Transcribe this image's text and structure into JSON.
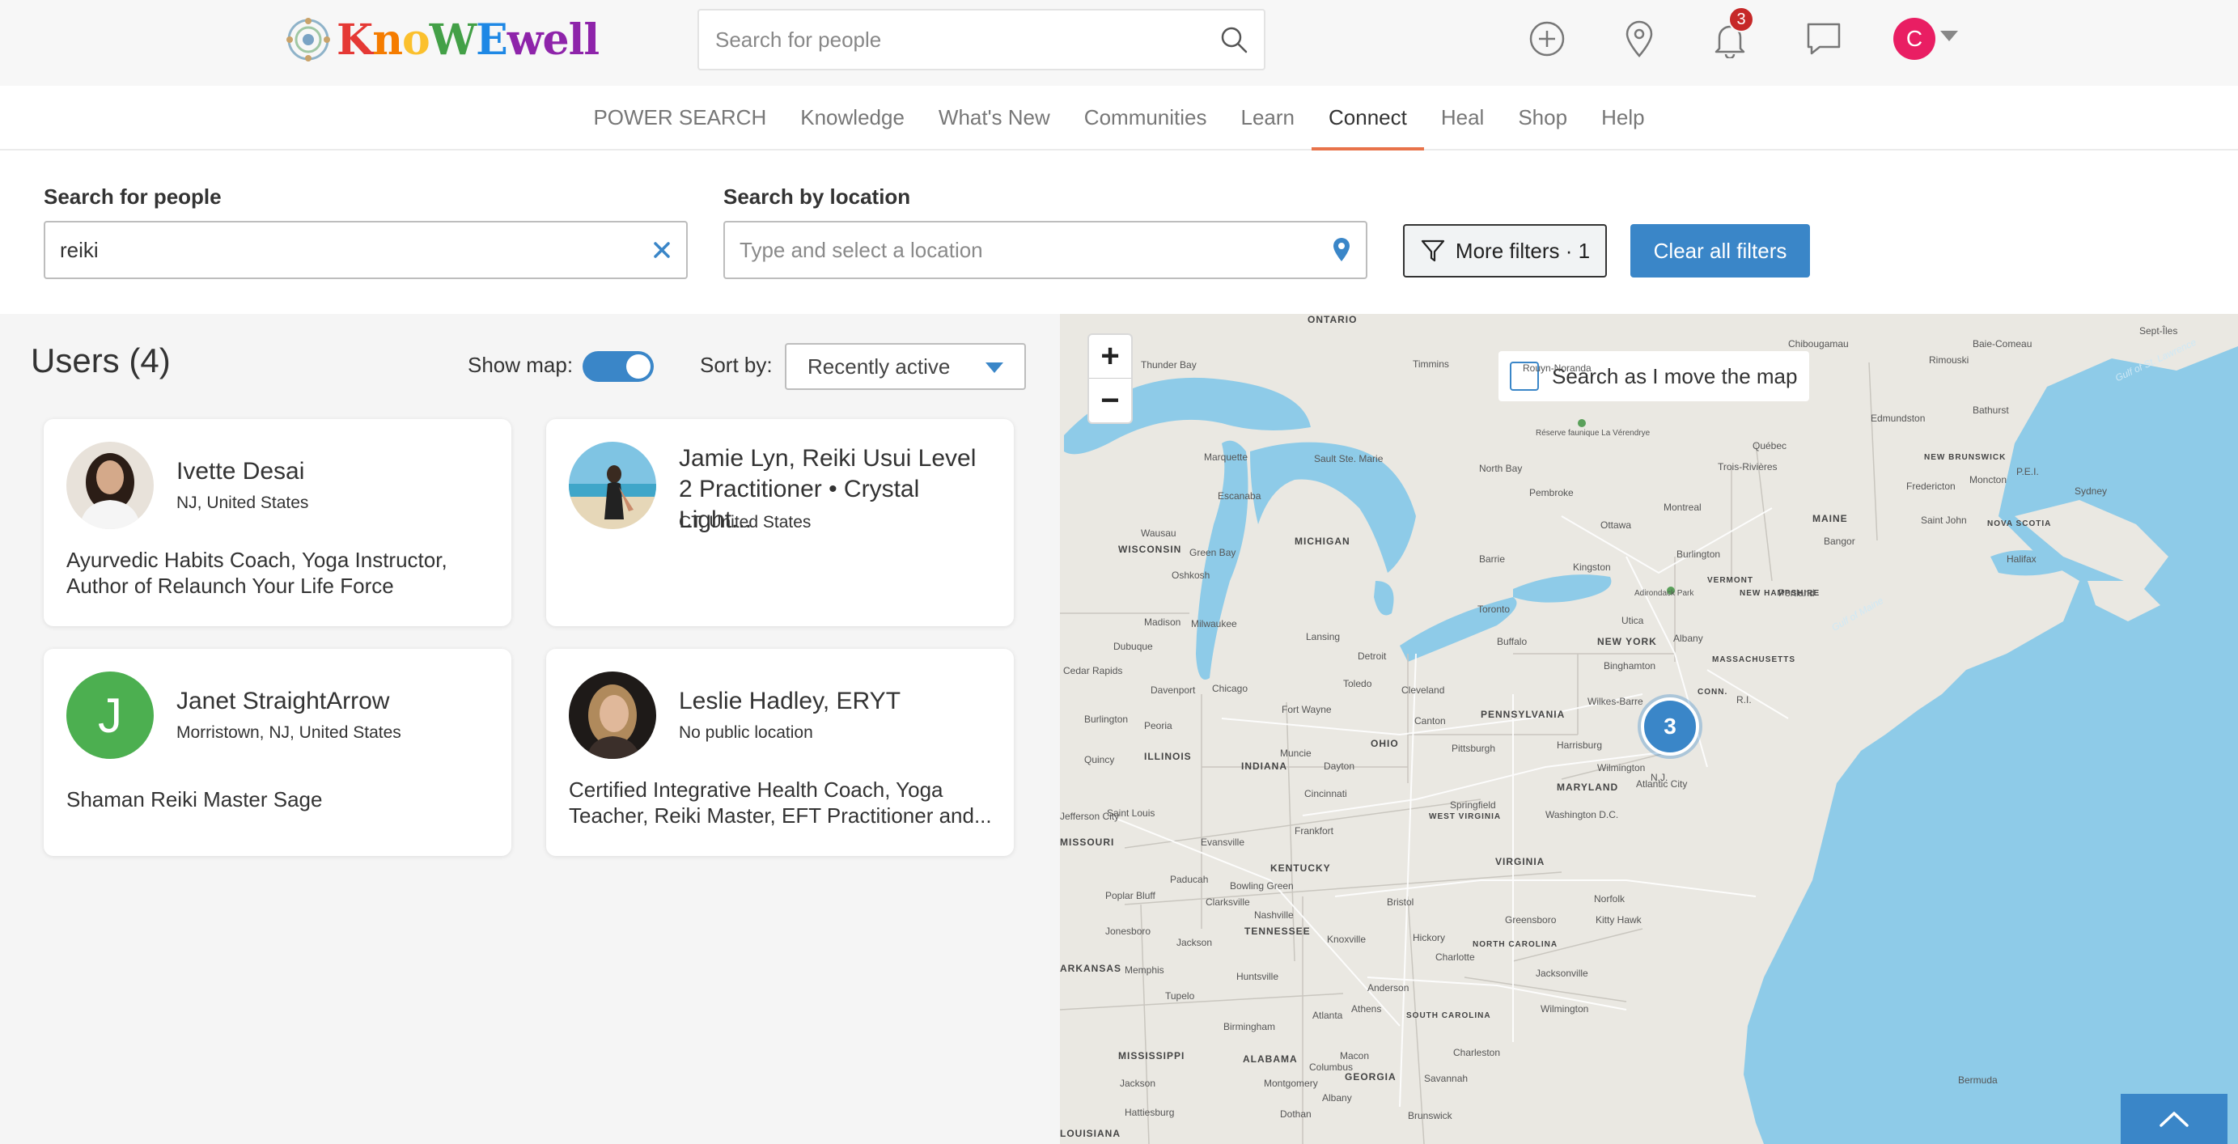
{
  "header": {
    "logo_text": "KnoWEwell",
    "search_placeholder": "Search for people",
    "notification_count": "3",
    "user_initial": "C"
  },
  "nav": {
    "items": [
      {
        "label": "POWER SEARCH",
        "active": false
      },
      {
        "label": "Knowledge",
        "active": false
      },
      {
        "label": "What's New",
        "active": false
      },
      {
        "label": "Communities",
        "active": false
      },
      {
        "label": "Learn",
        "active": false
      },
      {
        "label": "Connect",
        "active": true
      },
      {
        "label": "Heal",
        "active": false
      },
      {
        "label": "Shop",
        "active": false
      },
      {
        "label": "Help",
        "active": false
      }
    ]
  },
  "filters": {
    "people_label": "Search for people",
    "people_value": "reiki",
    "location_label": "Search by location",
    "location_placeholder": "Type and select a location",
    "more_filters_label": "More filters · 1",
    "clear_filters_label": "Clear all filters"
  },
  "results": {
    "title": "Users (4)",
    "show_map_label": "Show map:",
    "show_map_on": true,
    "sort_label": "Sort by:",
    "sort_value": "Recently active",
    "users": [
      {
        "name": "Ivette Desai",
        "location": "NJ, United States",
        "description": "Ayurvedic Habits Coach, Yoga Instructor, Author of Relaunch Your Life Force"
      },
      {
        "name": "Jamie Lyn, Reiki Usui Level 2 Practitioner • Crystal Light...",
        "location": "CT, United States",
        "description": ""
      },
      {
        "name": "Janet StraightArrow",
        "initial": "J",
        "location": "Morristown, NJ, United States",
        "description": "Shaman Reiki Master Sage"
      },
      {
        "name": "Leslie Hadley, ERYT",
        "location": "No public location",
        "description": "Certified Integrative Health Coach, Yoga Teacher, Reiki Master, EFT Practitioner and..."
      }
    ]
  },
  "map": {
    "zoom_in": "+",
    "zoom_out": "−",
    "search_as_move_label": "Search as I move the map",
    "cluster_count": "3",
    "labels": [
      {
        "text": "ONTARIO",
        "state": true
      },
      {
        "text": "Thunder Bay"
      },
      {
        "text": "Timmins"
      },
      {
        "text": "Rouyn-Noranda"
      },
      {
        "text": "Chibougamau"
      },
      {
        "text": "Baie-Comeau"
      },
      {
        "text": "Sept-Îles"
      },
      {
        "text": "Réserve faunique La Vérendrye"
      },
      {
        "text": "Marquette"
      },
      {
        "text": "Sault Ste. Marie"
      },
      {
        "text": "North Bay"
      },
      {
        "text": "Rimouski"
      },
      {
        "text": "Edmundston"
      },
      {
        "text": "Bathurst"
      },
      {
        "text": "Escanaba"
      },
      {
        "text": "Pembroke"
      },
      {
        "text": "Trois-Rivières"
      },
      {
        "text": "Québec"
      },
      {
        "text": "NEW BRUNSWICK",
        "state": true
      },
      {
        "text": "Moncton"
      },
      {
        "text": "P.E.I."
      },
      {
        "text": "Fredericton"
      },
      {
        "text": "Sydney"
      },
      {
        "text": "Wausau"
      },
      {
        "text": "MICHIGAN",
        "state": true
      },
      {
        "text": "Montreal"
      },
      {
        "text": "MAINE",
        "state": true
      },
      {
        "text": "Saint John"
      },
      {
        "text": "WISCONSIN",
        "state": true
      },
      {
        "text": "Green Bay"
      },
      {
        "text": "Ottawa"
      },
      {
        "text": "Bangor"
      },
      {
        "text": "NOVA SCOTIA",
        "state": true
      },
      {
        "text": "Oshkosh"
      },
      {
        "text": "Barrie"
      },
      {
        "text": "Kingston"
      },
      {
        "text": "Burlington"
      },
      {
        "text": "VERMONT",
        "state": true
      },
      {
        "text": "Halifax"
      },
      {
        "text": "Adirondack Park"
      },
      {
        "text": "NEW HAMPSHIRE",
        "state": true
      },
      {
        "text": "Portland"
      },
      {
        "text": "Madison"
      },
      {
        "text": "Milwaukee"
      },
      {
        "text": "Toronto"
      },
      {
        "text": "Utica"
      },
      {
        "text": "Lansing"
      },
      {
        "text": "Buffalo"
      },
      {
        "text": "Albany"
      },
      {
        "text": "Dubuque"
      },
      {
        "text": "NEW YORK",
        "state": true
      },
      {
        "text": "Detroit"
      },
      {
        "text": "MASSACHUSETTS",
        "state": true
      },
      {
        "text": "Cedar Rapids"
      },
      {
        "text": "Binghamton"
      },
      {
        "text": "Davenport"
      },
      {
        "text": "Chicago"
      },
      {
        "text": "Toledo"
      },
      {
        "text": "Cleveland"
      },
      {
        "text": "CONN.",
        "state": true
      },
      {
        "text": "R.I."
      },
      {
        "text": "Fort Wayne"
      },
      {
        "text": "Wilkes-Barre"
      },
      {
        "text": "PENNSYLVANIA",
        "state": true
      },
      {
        "text": "Burlington"
      },
      {
        "text": "Peoria"
      },
      {
        "text": "Canton"
      },
      {
        "text": "ILLINOIS",
        "state": true
      },
      {
        "text": "OHIO",
        "state": true
      },
      {
        "text": "Pittsburgh"
      },
      {
        "text": "Harrisburg"
      },
      {
        "text": "Quincy"
      },
      {
        "text": "Muncie"
      },
      {
        "text": "INDIANA",
        "state": true
      },
      {
        "text": "Dayton"
      },
      {
        "text": "Wilmington"
      },
      {
        "text": "MARYLAND",
        "state": true
      },
      {
        "text": "N.J."
      },
      {
        "text": "Cincinnati"
      },
      {
        "text": "Atlantic City"
      },
      {
        "text": "Springfield"
      },
      {
        "text": "WEST VIRGINIA",
        "state": true
      },
      {
        "text": "Washington D.C."
      },
      {
        "text": "Jefferson City"
      },
      {
        "text": "Saint Louis"
      },
      {
        "text": "Evansville"
      },
      {
        "text": "Frankfort"
      },
      {
        "text": "MISSOURI",
        "state": true
      },
      {
        "text": "VIRGINIA",
        "state": true
      },
      {
        "text": "KENTUCKY",
        "state": true
      },
      {
        "text": "Bowling Green"
      },
      {
        "text": "Poplar Bluff"
      },
      {
        "text": "Paducah"
      },
      {
        "text": "Clarksville"
      },
      {
        "text": "Bristol"
      },
      {
        "text": "Norfolk"
      },
      {
        "text": "Kitty Hawk"
      },
      {
        "text": "Greensboro"
      },
      {
        "text": "Jonesboro"
      },
      {
        "text": "Nashville"
      },
      {
        "text": "Hickory"
      },
      {
        "text": "Jackson"
      },
      {
        "text": "TENNESSEE",
        "state": true
      },
      {
        "text": "Knoxville"
      },
      {
        "text": "NORTH CAROLINA",
        "state": true
      },
      {
        "text": "Memphis"
      },
      {
        "text": "Charlotte"
      },
      {
        "text": "Jacksonville"
      },
      {
        "text": "ARKANSAS",
        "state": true
      },
      {
        "text": "Huntsville"
      },
      {
        "text": "Tupelo"
      },
      {
        "text": "Anderson"
      },
      {
        "text": "Atlanta"
      },
      {
        "text": "Athens"
      },
      {
        "text": "SOUTH CAROLINA",
        "state": true
      },
      {
        "text": "Wilmington"
      },
      {
        "text": "Birmingham"
      },
      {
        "text": "Macon"
      },
      {
        "text": "Charleston"
      },
      {
        "text": "MISSISSIPPI",
        "state": true
      },
      {
        "text": "ALABAMA",
        "state": true
      },
      {
        "text": "Columbus"
      },
      {
        "text": "GEORGIA",
        "state": true
      },
      {
        "text": "Savannah"
      },
      {
        "text": "Jackson"
      },
      {
        "text": "Montgomery"
      },
      {
        "text": "Albany"
      },
      {
        "text": "Brunswick"
      },
      {
        "text": "Bermuda"
      },
      {
        "text": "Hattiesburg"
      },
      {
        "text": "Dothan"
      },
      {
        "text": "LOUISIANA",
        "state": true
      },
      {
        "text": "Gulf of Maine"
      },
      {
        "text": "Gulf of St. Lawrence"
      }
    ]
  },
  "colors": {
    "accent": "#3a86c8",
    "active_tab_underline": "#e8734a",
    "badge": "#c62828",
    "avatar": "#e91e63",
    "initial_avatar": "#4caf50",
    "water": "#8ecbe8",
    "land": "#eae8e2"
  }
}
